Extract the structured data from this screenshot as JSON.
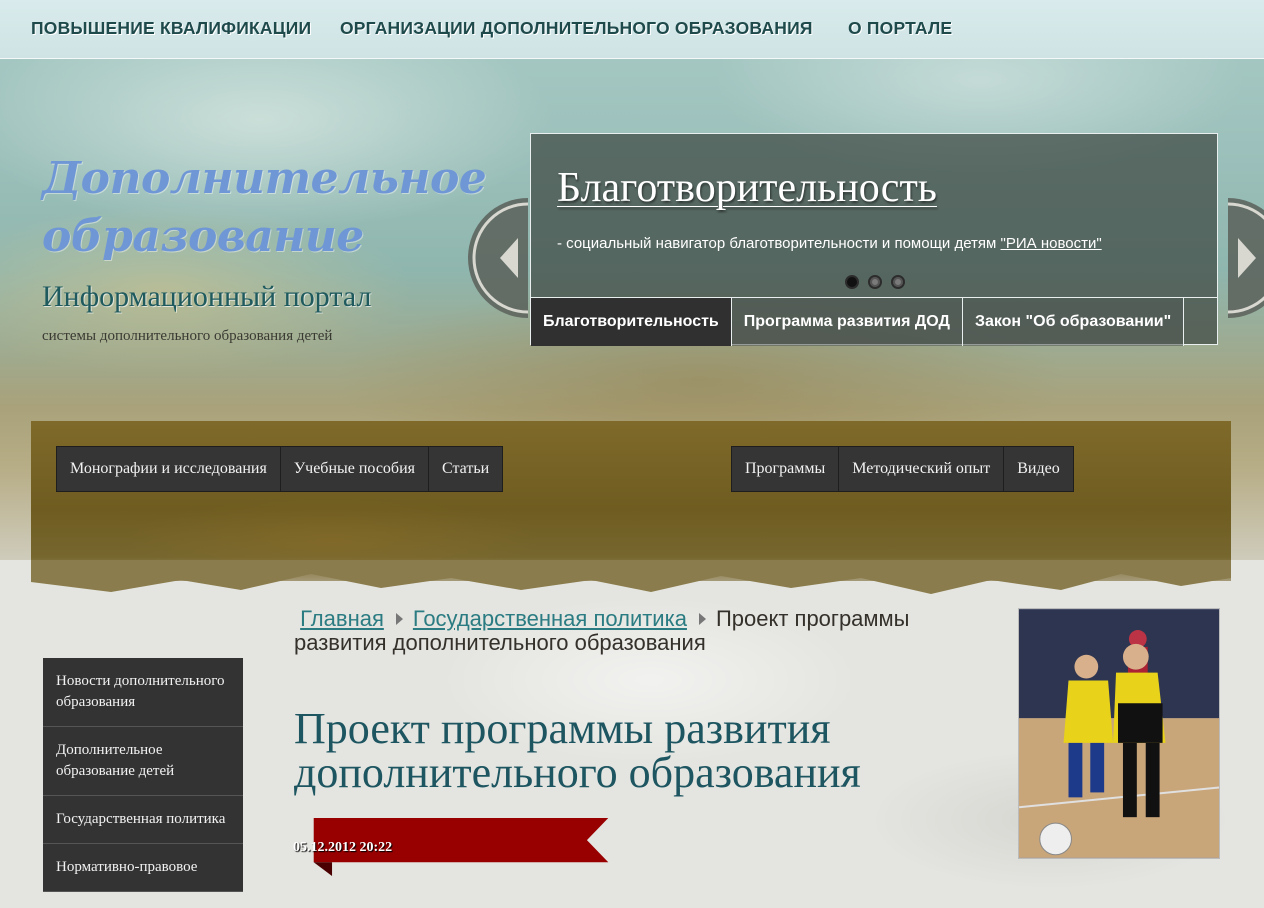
{
  "top_nav": {
    "items": [
      {
        "label": "ПОВЫШЕНИЕ КВАЛИФИКАЦИИ"
      },
      {
        "label": "ОРГАНИЗАЦИИ ДОПОЛНИТЕЛЬНОГО ОБРАЗОВАНИЯ"
      },
      {
        "label": "О ПОРТАЛЕ"
      }
    ]
  },
  "header": {
    "logo_line1": "Дополнительное",
    "logo_line2": "образование",
    "title": "Информационный портал",
    "subtitle": "системы дополнительного образования детей"
  },
  "slider": {
    "title": "Благотворительность",
    "text": "- социальный навигатор благотворительности и помощи детям ",
    "link": "\"РИА новости\"",
    "active_dot": 0,
    "tabs": [
      {
        "label": "Благотворительность"
      },
      {
        "label": "Программа развития ДОД"
      },
      {
        "label": "Закон \"Об образовании\""
      }
    ]
  },
  "secondary_nav": {
    "left": [
      {
        "label": "Монографии и исследования"
      },
      {
        "label": "Учебные пособия"
      },
      {
        "label": "Статьи"
      }
    ],
    "right": [
      {
        "label": "Программы"
      },
      {
        "label": "Методический опыт"
      },
      {
        "label": "Видео"
      }
    ]
  },
  "sidebar": {
    "items": [
      {
        "label": "Новости дополнительного образования"
      },
      {
        "label": "Дополнительное образование детей"
      },
      {
        "label": "Государственная политика"
      },
      {
        "label": "Нормативно-правовое"
      }
    ]
  },
  "breadcrumb": {
    "home": "Главная",
    "section": "Государственная политика",
    "current": "Проект программы развития дополнительного образования"
  },
  "article": {
    "title": "Проект программы развития дополнительного образования",
    "date": "05.12.2012 20:22"
  },
  "colors": {
    "accent_teal": "#1d5560",
    "link": "#2a7c82",
    "ribbon_red": "#9b0000",
    "nav_dark": "#353535"
  }
}
